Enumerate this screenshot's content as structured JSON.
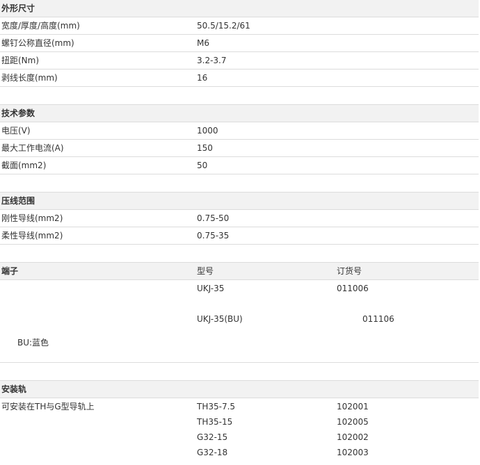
{
  "dimensions": {
    "title": "外形尺寸",
    "rows": [
      {
        "label": "宽度/厚度/高度(mm)",
        "value": "50.5/15.2/61"
      },
      {
        "label": "螺钉公称直径(mm)",
        "value": "M6"
      },
      {
        "label": "扭距(Nm)",
        "value": "3.2-3.7"
      },
      {
        "label": "剥线长度(mm)",
        "value": "16"
      }
    ]
  },
  "technical": {
    "title": "技术参数",
    "rows": [
      {
        "label": "电压(V)",
        "value": "1000"
      },
      {
        "label": "最大工作电流(A)",
        "value": "150"
      },
      {
        "label": "截面(mm2)",
        "value": "50"
      }
    ]
  },
  "crimp": {
    "title": "压线范围",
    "rows": [
      {
        "label": "刚性导线(mm2)",
        "value": "0.75-50"
      },
      {
        "label": "柔性导线(mm2)",
        "value": "0.75-35"
      }
    ]
  },
  "terminal": {
    "title": "端子",
    "col_model": "型号",
    "col_order": "订货号",
    "items": [
      {
        "model": "UKJ-35",
        "order": "011006"
      },
      {
        "model": "UKJ-35(BU)",
        "order": "011106"
      }
    ],
    "note": "BU:蓝色"
  },
  "rail": {
    "title": "安装轨",
    "label": "可安装在TH与G型导轨上",
    "items": [
      {
        "model": "TH35-7.5",
        "order": "102001"
      },
      {
        "model": "TH35-15",
        "order": "102005"
      },
      {
        "model": "G32-15",
        "order": "102002"
      },
      {
        "model": "G32-18",
        "order": "102003"
      }
    ]
  }
}
